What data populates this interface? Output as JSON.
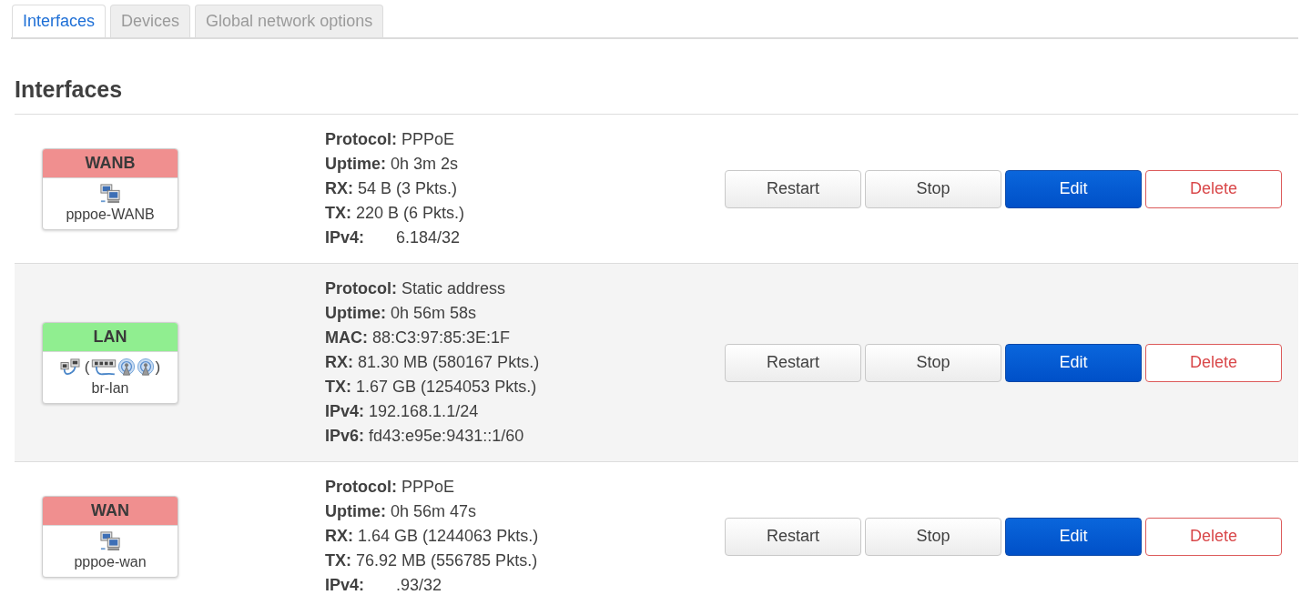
{
  "tabs": [
    {
      "label": "Interfaces",
      "selected": true
    },
    {
      "label": "Devices",
      "selected": false
    },
    {
      "label": "Global network options",
      "selected": false
    }
  ],
  "heading": "Interfaces",
  "interfaces": [
    {
      "name": "WANB",
      "color": "#f08f8f",
      "devices": [
        {
          "kind": "pppoe"
        }
      ],
      "device_name": "pppoe-WANB",
      "details": [
        {
          "label": "Protocol:",
          "value": "PPPoE",
          "masked": false
        },
        {
          "label": "Uptime:",
          "value": "0h 3m 2s",
          "masked": false
        },
        {
          "label": "RX:",
          "value": "54 B (3 Pkts.)",
          "masked": false
        },
        {
          "label": "TX:",
          "value": "220 B (6 Pkts.)",
          "masked": false
        },
        {
          "label": "IPv4:",
          "value": "6.184/32",
          "masked": true
        }
      ],
      "buttons": [
        {
          "label": "Restart",
          "kind": "default"
        },
        {
          "label": "Stop",
          "kind": "default"
        },
        {
          "label": "Edit",
          "kind": "primary"
        },
        {
          "label": "Delete",
          "kind": "danger"
        }
      ]
    },
    {
      "name": "LAN",
      "color": "#90ee90",
      "devices": [
        {
          "kind": "bridge"
        },
        {
          "kind": "text",
          "text": "("
        },
        {
          "kind": "switch"
        },
        {
          "kind": "wireless"
        },
        {
          "kind": "wireless"
        },
        {
          "kind": "text",
          "text": ")"
        }
      ],
      "device_name": "br-lan",
      "details": [
        {
          "label": "Protocol:",
          "value": "Static address",
          "masked": false
        },
        {
          "label": "Uptime:",
          "value": "0h 56m 58s",
          "masked": false
        },
        {
          "label": "MAC:",
          "value": "88:C3:97:85:3E:1F",
          "masked": false
        },
        {
          "label": "RX:",
          "value": "81.30 MB (580167 Pkts.)",
          "masked": false
        },
        {
          "label": "TX:",
          "value": "1.67 GB (1254053 Pkts.)",
          "masked": false
        },
        {
          "label": "IPv4:",
          "value": "192.168.1.1/24",
          "masked": false
        },
        {
          "label": "IPv6:",
          "value": "fd43:e95e:9431::1/60",
          "masked": false
        }
      ],
      "buttons": [
        {
          "label": "Restart",
          "kind": "default"
        },
        {
          "label": "Stop",
          "kind": "default"
        },
        {
          "label": "Edit",
          "kind": "primary"
        },
        {
          "label": "Delete",
          "kind": "danger"
        }
      ]
    },
    {
      "name": "WAN",
      "color": "#f08f8f",
      "devices": [
        {
          "kind": "pppoe"
        }
      ],
      "device_name": "pppoe-wan",
      "details": [
        {
          "label": "Protocol:",
          "value": "PPPoE",
          "masked": false
        },
        {
          "label": "Uptime:",
          "value": "0h 56m 47s",
          "masked": false
        },
        {
          "label": "RX:",
          "value": "1.64 GB (1244063 Pkts.)",
          "masked": false
        },
        {
          "label": "TX:",
          "value": "76.92 MB (556785 Pkts.)",
          "masked": false
        },
        {
          "label": "IPv4:",
          "value": ".93/32",
          "masked": true
        }
      ],
      "buttons": [
        {
          "label": "Restart",
          "kind": "default"
        },
        {
          "label": "Stop",
          "kind": "default"
        },
        {
          "label": "Edit",
          "kind": "primary"
        },
        {
          "label": "Delete",
          "kind": "danger"
        }
      ]
    }
  ]
}
